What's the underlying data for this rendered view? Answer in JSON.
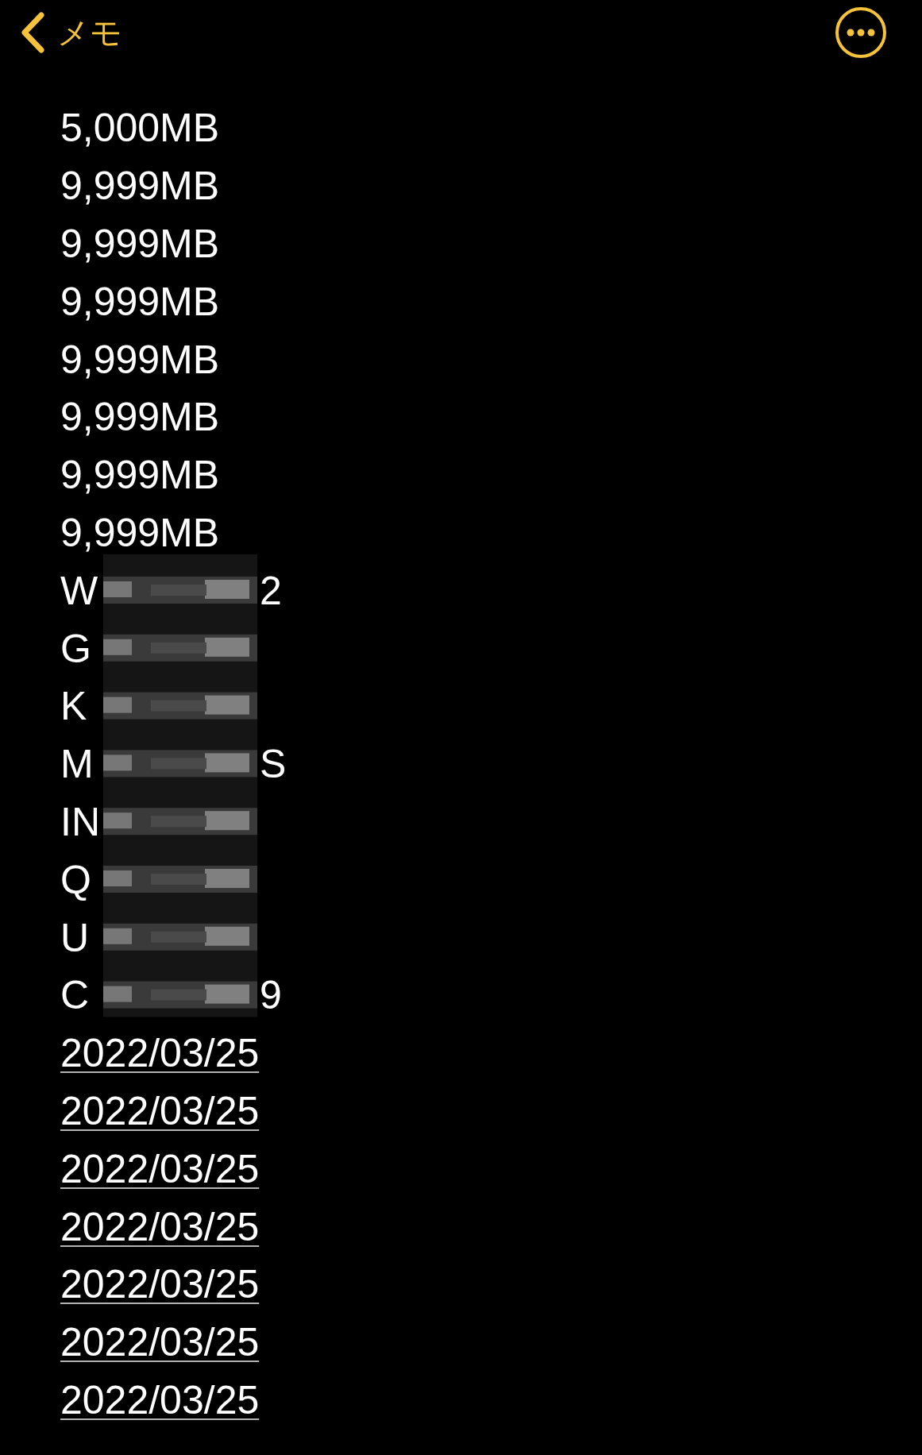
{
  "nav_bar": {
    "back_label": "メモ"
  },
  "lines": [
    {
      "kind": "plain",
      "text": "5,000MB"
    },
    {
      "kind": "plain",
      "text": "9,999MB"
    },
    {
      "kind": "plain",
      "text": "9,999MB"
    },
    {
      "kind": "plain",
      "text": "9,999MB"
    },
    {
      "kind": "plain",
      "text": "9,999MB"
    },
    {
      "kind": "plain",
      "text": "9,999MB"
    },
    {
      "kind": "plain",
      "text": "9,999MB"
    },
    {
      "kind": "plain",
      "text": "9,999MB"
    },
    {
      "kind": "redacted",
      "start": "W",
      "end": "2"
    },
    {
      "kind": "redacted",
      "start": "G"
    },
    {
      "kind": "redacted",
      "start": "K"
    },
    {
      "kind": "redacted",
      "start": "M",
      "end": "S"
    },
    {
      "kind": "redacted",
      "start": "IN"
    },
    {
      "kind": "redacted",
      "start": "Q"
    },
    {
      "kind": "redacted",
      "start": "U"
    },
    {
      "kind": "redacted",
      "start": "C",
      "end": "9"
    },
    {
      "kind": "link",
      "text": "2022/03/25"
    },
    {
      "kind": "link",
      "text": "2022/03/25"
    },
    {
      "kind": "link",
      "text": "2022/03/25"
    },
    {
      "kind": "link",
      "text": "2022/03/25"
    },
    {
      "kind": "link",
      "text": "2022/03/25"
    },
    {
      "kind": "link",
      "text": "2022/03/25"
    },
    {
      "kind": "link",
      "text": "2022/03/25"
    }
  ]
}
